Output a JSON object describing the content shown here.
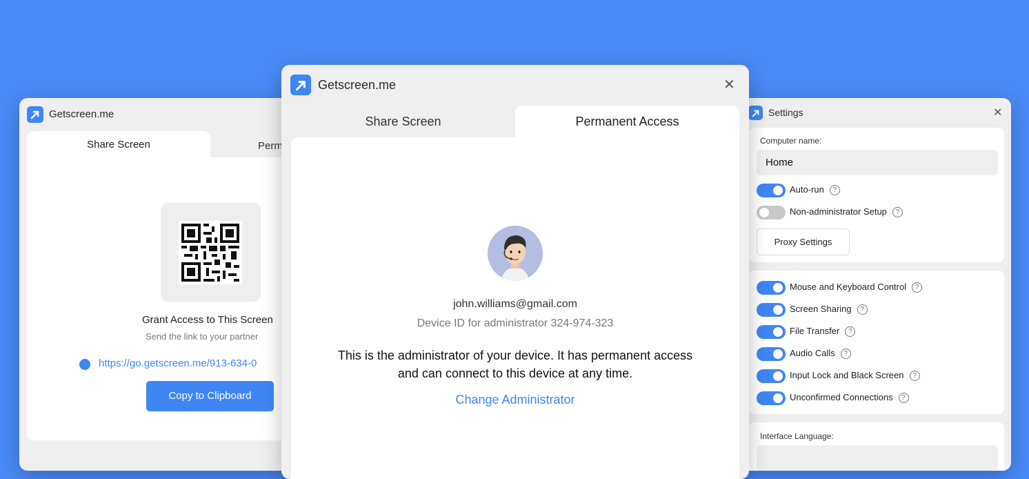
{
  "colors": {
    "background": "#4a8af7",
    "accent": "#3f86f5"
  },
  "left_window": {
    "title": "Getscreen.me",
    "tabs": [
      {
        "label": "Share Screen"
      },
      {
        "label": "Perm"
      }
    ],
    "grant_title": "Grant Access to This Screen",
    "grant_subtitle": "Send the link to your partner",
    "link": "https://go.getscreen.me/913-634-0",
    "copy_button": "Copy to Clipboard"
  },
  "main_window": {
    "title": "Getscreen.me",
    "tabs": [
      {
        "label": "Share Screen"
      },
      {
        "label": "Permanent Access"
      }
    ],
    "email": "john.williams@gmail.com",
    "device_id": "Device ID for administrator 324-974-323",
    "description_line1": "This is the administrator of your device. It has permanent access",
    "description_line2": "and can connect to this device at any time.",
    "change_link": "Change Administrator"
  },
  "settings_window": {
    "title": "Settings",
    "computer_name_label": "Computer name:",
    "computer_name_value": "Home",
    "toggles_top": [
      {
        "label": "Auto-run",
        "on": true
      },
      {
        "label": "Non-administrator Setup",
        "on": false
      }
    ],
    "proxy_button": "Proxy Settings",
    "toggles_permissions": [
      {
        "label": "Mouse and Keyboard Control",
        "on": true
      },
      {
        "label": "Screen Sharing",
        "on": true
      },
      {
        "label": "File Transfer",
        "on": true
      },
      {
        "label": "Audio Calls",
        "on": true
      },
      {
        "label": "Input Lock and Black Screen",
        "on": true
      },
      {
        "label": "Unconfirmed Connections",
        "on": true
      }
    ],
    "language_label": "Interface Language:"
  }
}
